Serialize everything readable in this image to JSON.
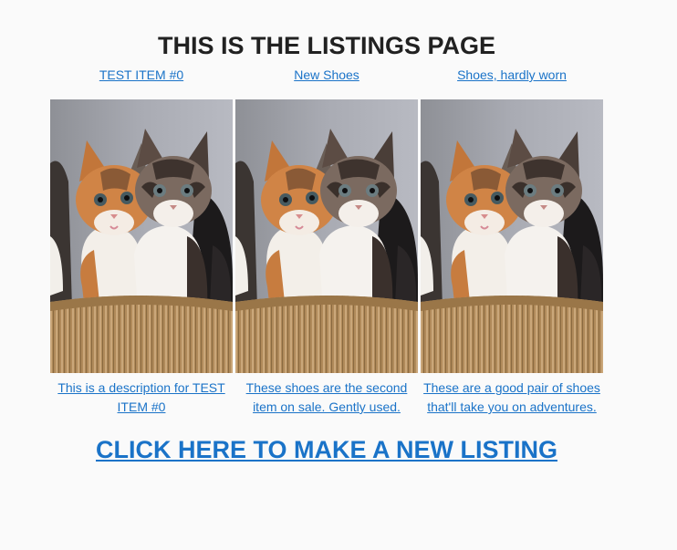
{
  "page": {
    "title": "THIS IS THE LISTINGS PAGE"
  },
  "listings": [
    {
      "name": "TEST ITEM #0",
      "image": "kittens-photo",
      "description": "This is a description for TEST ITEM #0"
    },
    {
      "name": "New Shoes",
      "image": "kittens-photo",
      "description": "These shoes are the second item on sale. Gently used."
    },
    {
      "name": "Shoes, hardly worn",
      "image": "kittens-photo",
      "description": "These are a good pair of shoes that'll take you on adventures."
    }
  ],
  "cta": {
    "label": "CLICK HERE TO MAKE A NEW LISTING"
  },
  "colors": {
    "background": "#fafafa",
    "link": "#1a73c8",
    "heading": "#212121"
  }
}
